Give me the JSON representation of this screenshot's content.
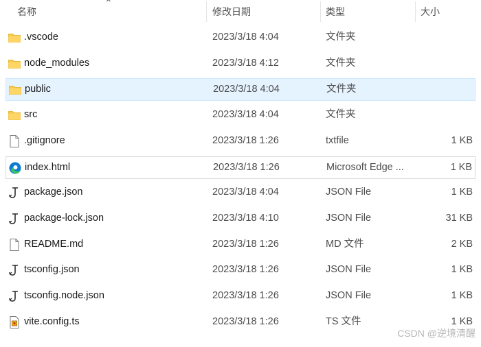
{
  "columns": {
    "name": "名称",
    "date": "修改日期",
    "type": "类型",
    "size": "大小"
  },
  "files": [
    {
      "name": ".vscode",
      "date": "2023/3/18 4:04",
      "type": "文件夹",
      "size": "",
      "icon": "folder-icon"
    },
    {
      "name": "node_modules",
      "date": "2023/3/18 4:12",
      "type": "文件夹",
      "size": "",
      "icon": "folder-icon"
    },
    {
      "name": "public",
      "date": "2023/3/18 4:04",
      "type": "文件夹",
      "size": "",
      "icon": "folder-icon"
    },
    {
      "name": "src",
      "date": "2023/3/18 4:04",
      "type": "文件夹",
      "size": "",
      "icon": "folder-icon"
    },
    {
      "name": ".gitignore",
      "date": "2023/3/18 1:26",
      "type": "txtfile",
      "size": "1 KB",
      "icon": "text-file-icon"
    },
    {
      "name": "index.html",
      "date": "2023/3/18 1:26",
      "type": "Microsoft Edge ...",
      "size": "1 KB",
      "icon": "edge-icon"
    },
    {
      "name": "package.json",
      "date": "2023/3/18 4:04",
      "type": "JSON File",
      "size": "1 KB",
      "icon": "json-file-icon"
    },
    {
      "name": "package-lock.json",
      "date": "2023/3/18 4:10",
      "type": "JSON File",
      "size": "31 KB",
      "icon": "json-file-icon"
    },
    {
      "name": "README.md",
      "date": "2023/3/18 1:26",
      "type": "MD 文件",
      "size": "2 KB",
      "icon": "text-file-icon"
    },
    {
      "name": "tsconfig.json",
      "date": "2023/3/18 1:26",
      "type": "JSON File",
      "size": "1 KB",
      "icon": "json-file-icon"
    },
    {
      "name": "tsconfig.node.json",
      "date": "2023/3/18 1:26",
      "type": "JSON File",
      "size": "1 KB",
      "icon": "json-file-icon"
    },
    {
      "name": "vite.config.ts",
      "date": "2023/3/18 1:26",
      "type": "TS 文件",
      "size": "1 KB",
      "icon": "ts-file-icon"
    }
  ],
  "selected_index": 2,
  "focused_index": 5,
  "watermark": "CSDN @逆境清醒",
  "colors": {
    "folder": "#f7c948",
    "selection": "#e5f3ff",
    "edge_blue": "#0c7bd6",
    "edge_green": "#3cc45a"
  }
}
